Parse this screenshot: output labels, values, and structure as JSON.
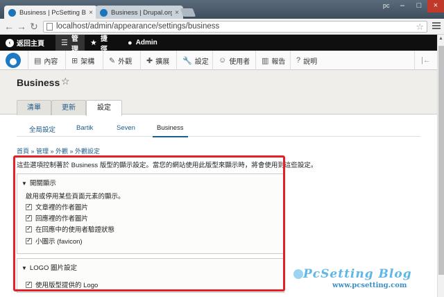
{
  "browser": {
    "tabs": [
      {
        "title": "Business | PcSetting Blo",
        "active": true
      },
      {
        "title": "Business | Drupal.org",
        "active": false
      }
    ],
    "user_label": "pc",
    "url": "localhost/admin/appearance/settings/business"
  },
  "admin_bar": {
    "back_label": "返回主頁",
    "manage_label": "管理",
    "shortcuts_label": "捷徑",
    "user_label": "Admin"
  },
  "admin_tray": {
    "items": [
      "內容",
      "架構",
      "外觀",
      "擴展",
      "設定",
      "使用者",
      "報告",
      "說明"
    ]
  },
  "header": {
    "title": "Business",
    "tabs": [
      "清單",
      "更新",
      "設定"
    ],
    "active_tab": "設定"
  },
  "secondary_tabs": {
    "items": [
      "全局設定",
      "Bartik",
      "Seven",
      "Business"
    ],
    "active": "Business"
  },
  "breadcrumb": "首頁 » 管理 » 外觀 » 外觀設定",
  "description": "這些選項控制著於 Business 版型的顯示設定。當您的網站使用此版型來顯示時，將會使用到這些設定。",
  "toggle_display": {
    "legend": "開關顯示",
    "description": "啟用或停用某些頁面元素的顯示。",
    "checkboxes": [
      {
        "label": "文章裡的作者圖片",
        "checked": true
      },
      {
        "label": "回應裡的作者圖片",
        "checked": true
      },
      {
        "label": "在回應中的使用者驗證狀態",
        "checked": true
      },
      {
        "label": "小圖示 (favicon)",
        "checked": true
      }
    ]
  },
  "logo_settings": {
    "legend": "LOGO 圖片設定",
    "checkboxes": [
      {
        "label": "使用版型提供的 Logo",
        "checked": true
      }
    ]
  },
  "watermark": {
    "title": "PcSetting Blog",
    "url": "www.pcsetting.com"
  },
  "colors": {
    "highlight": "#e41f26",
    "link": "#1e5c8a",
    "admin_bar": "#0f0f0f"
  }
}
